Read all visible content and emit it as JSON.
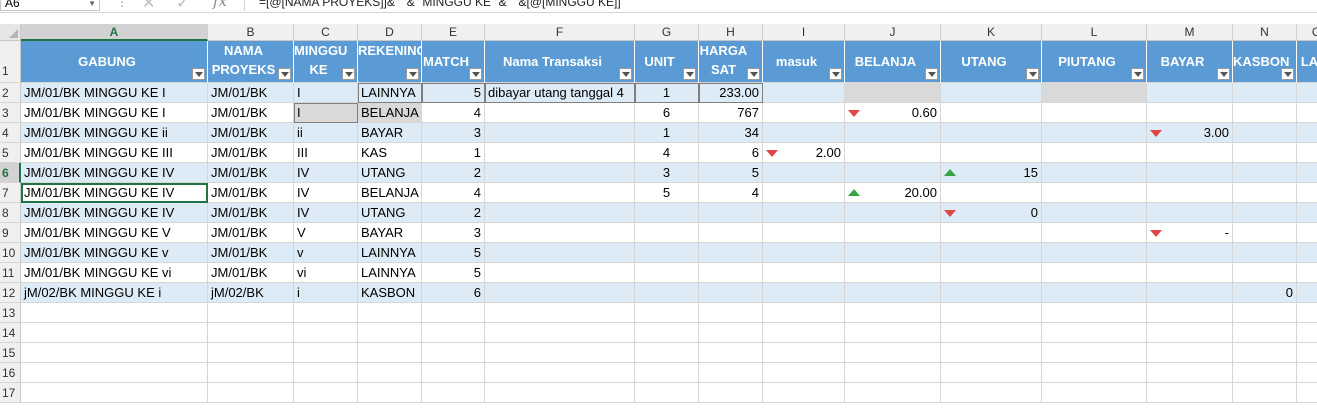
{
  "formula_bar": {
    "name_box": "A6",
    "formula": "=[@[NAMA PROYEKS]]&\" \"&\" MINGGU KE \"&\" \"&[@[MINGGU KE]]"
  },
  "columns": [
    "A",
    "B",
    "C",
    "D",
    "E",
    "F",
    "G",
    "H",
    "I",
    "J",
    "K",
    "L",
    "M",
    "N",
    "O"
  ],
  "rows": [
    "1",
    "2",
    "3",
    "4",
    "5",
    "6",
    "7",
    "8",
    "9",
    "10",
    "11",
    "12",
    "13",
    "14",
    "15",
    "16",
    "17"
  ],
  "headers": {
    "A": "GABUNG",
    "B": "NAMA PROYEKS",
    "C": "MINGGU KE",
    "D": "REKENING",
    "E": "MATCH",
    "F": "Nama Transaksi",
    "G": "UNIT",
    "H": "HARGA SAT",
    "I": "masuk",
    "J": "BELANJA",
    "K": "UTANG",
    "L": "PIUTANG",
    "M": "BAYAR",
    "N": "KASBON",
    "O": "LA"
  },
  "data": [
    {
      "A": "JM/01/BK MINGGU KE I",
      "B": "JM/01/BK",
      "C": "I",
      "D": "LAINNYA",
      "E": "5",
      "F": "dibayar utang tanggal 4",
      "G": "1",
      "H": "233.00",
      "I": "",
      "J": "",
      "K": "",
      "L": "",
      "M": "",
      "N": ""
    },
    {
      "A": "JM/01/BK MINGGU KE I",
      "B": "JM/01/BK",
      "C": "I",
      "D": "BELANJA",
      "E": "4",
      "F": "",
      "G": "6",
      "H": "767",
      "I": "",
      "J": "0.60",
      "K": "",
      "L": "",
      "M": "",
      "N": ""
    },
    {
      "A": "JM/01/BK MINGGU KE ii",
      "B": "JM/01/BK",
      "C": "ii",
      "D": "BAYAR",
      "E": "3",
      "F": "",
      "G": "1",
      "H": "34",
      "I": "",
      "J": "",
      "K": "",
      "L": "",
      "M": "3.00",
      "N": ""
    },
    {
      "A": "JM/01/BK MINGGU KE III",
      "B": "JM/01/BK",
      "C": "III",
      "D": "KAS",
      "E": "1",
      "F": "",
      "G": "4",
      "H": "6",
      "I": "2.00",
      "J": "",
      "K": "",
      "L": "",
      "M": "",
      "N": ""
    },
    {
      "A": "JM/01/BK MINGGU KE IV",
      "B": "JM/01/BK",
      "C": "IV",
      "D": "UTANG",
      "E": "2",
      "F": "",
      "G": "3",
      "H": "5",
      "I": "",
      "J": "",
      "K": "15",
      "L": "",
      "M": "",
      "N": ""
    },
    {
      "A": "JM/01/BK MINGGU KE IV",
      "B": "JM/01/BK",
      "C": "IV",
      "D": "BELANJA",
      "E": "4",
      "F": "",
      "G": "5",
      "H": "4",
      "I": "",
      "J": "20.00",
      "K": "",
      "L": "",
      "M": "",
      "N": ""
    },
    {
      "A": "JM/01/BK MINGGU KE IV",
      "B": "JM/01/BK",
      "C": "IV",
      "D": "UTANG",
      "E": "2",
      "F": "",
      "G": "",
      "H": "",
      "I": "",
      "J": "",
      "K": "0",
      "L": "",
      "M": "",
      "N": ""
    },
    {
      "A": "JM/01/BK MINGGU KE V",
      "B": "JM/01/BK",
      "C": "V",
      "D": "BAYAR",
      "E": "3",
      "F": "",
      "G": "",
      "H": "",
      "I": "",
      "J": "",
      "K": "",
      "L": "",
      "M": "-",
      "N": ""
    },
    {
      "A": "JM/01/BK MINGGU KE v",
      "B": "JM/01/BK",
      "C": "v",
      "D": "LAINNYA",
      "E": "5",
      "F": "",
      "G": "",
      "H": "",
      "I": "",
      "J": "",
      "K": "",
      "L": "",
      "M": "",
      "N": ""
    },
    {
      "A": "JM/01/BK MINGGU KE vi",
      "B": "JM/01/BK",
      "C": "vi",
      "D": "LAINNYA",
      "E": "5",
      "F": "",
      "G": "",
      "H": "",
      "I": "",
      "J": "",
      "K": "",
      "L": "",
      "M": "",
      "N": ""
    },
    {
      "A": "jM/02/BK MINGGU KE i",
      "B": "jM/02/BK",
      "C": "i",
      "D": "KASBON",
      "E": "6",
      "F": "",
      "G": "",
      "H": "",
      "I": "",
      "J": "",
      "K": "",
      "L": "",
      "M": "",
      "N": "0"
    }
  ],
  "indicators": [
    {
      "row": 1,
      "col": "J",
      "kind": "down"
    },
    {
      "row": 2,
      "col": "M",
      "kind": "down"
    },
    {
      "row": 3,
      "col": "I",
      "kind": "down"
    },
    {
      "row": 4,
      "col": "K",
      "kind": "up"
    },
    {
      "row": 5,
      "col": "J",
      "kind": "up"
    },
    {
      "row": 6,
      "col": "K",
      "kind": "down"
    },
    {
      "row": 7,
      "col": "M",
      "kind": "down"
    }
  ],
  "icons": {
    "cancel": "cancel-x-icon",
    "enter": "check-icon",
    "function": "fx-icon"
  },
  "colors": {
    "header_fill": "#5b9bd5",
    "band_fill": "#ddebf7",
    "gray_fill": "#d9d9d9",
    "selection": "#217346",
    "down_indicator": "#e04646",
    "up_indicator": "#35a447"
  }
}
